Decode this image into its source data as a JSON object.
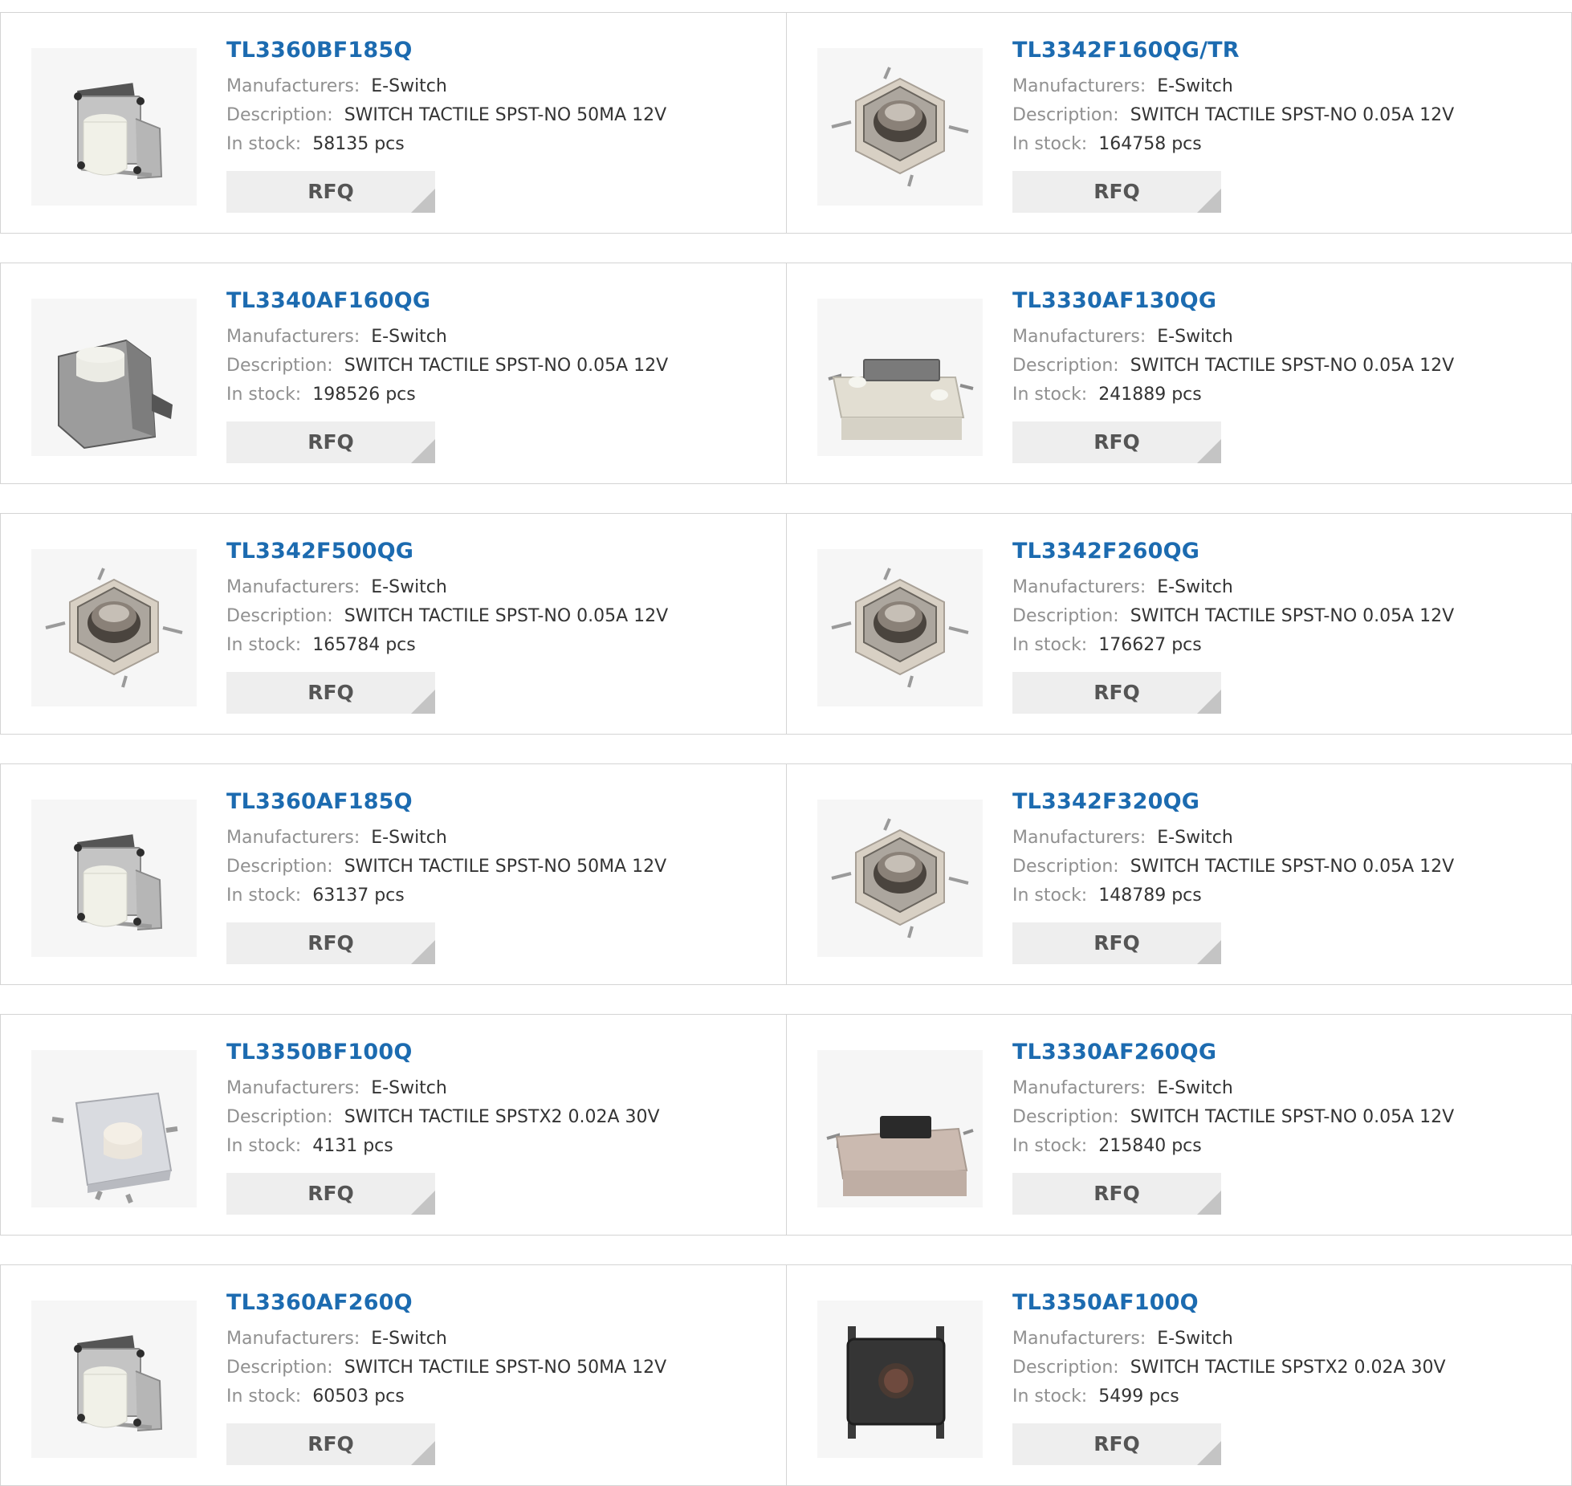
{
  "labels": {
    "manufacturers": "Manufacturers:",
    "description": "Description:",
    "in_stock": "In stock:",
    "rfq": "RFQ"
  },
  "products": [
    {
      "name": "TL3360BF185Q",
      "manufacturer": "E-Switch",
      "description": "SWITCH TACTILE SPST-NO 50MA 12V",
      "stock": "58135 pcs",
      "image_icon": "side-actuator-switch-icon"
    },
    {
      "name": "TL3342F160QG/TR",
      "manufacturer": "E-Switch",
      "description": "SWITCH TACTILE SPST-NO 0.05A 12V",
      "stock": "164758 pcs",
      "image_icon": "square-smd-switch-icon"
    },
    {
      "name": "TL3340AF160QG",
      "manufacturer": "E-Switch",
      "description": "SWITCH TACTILE SPST-NO 0.05A 12V",
      "stock": "198526 pcs",
      "image_icon": "right-angle-switch-icon"
    },
    {
      "name": "TL3330AF130QG",
      "manufacturer": "E-Switch",
      "description": "SWITCH TACTILE SPST-NO 0.05A 12V",
      "stock": "241889 pcs",
      "image_icon": "side-slim-switch-gray-icon"
    },
    {
      "name": "TL3342F500QG",
      "manufacturer": "E-Switch",
      "description": "SWITCH TACTILE SPST-NO 0.05A 12V",
      "stock": "165784 pcs",
      "image_icon": "square-smd-switch-icon"
    },
    {
      "name": "TL3342F260QG",
      "manufacturer": "E-Switch",
      "description": "SWITCH TACTILE SPST-NO 0.05A 12V",
      "stock": "176627 pcs",
      "image_icon": "square-smd-switch-icon"
    },
    {
      "name": "TL3360AF185Q",
      "manufacturer": "E-Switch",
      "description": "SWITCH TACTILE SPST-NO 50MA 12V",
      "stock": "63137 pcs",
      "image_icon": "side-actuator-switch-icon"
    },
    {
      "name": "TL3342F320QG",
      "manufacturer": "E-Switch",
      "description": "SWITCH TACTILE SPST-NO 0.05A 12V",
      "stock": "148789 pcs",
      "image_icon": "square-smd-switch-icon"
    },
    {
      "name": "TL3350BF100Q",
      "manufacturer": "E-Switch",
      "description": "SWITCH TACTILE SPSTX2 0.02A 30V",
      "stock": "4131 pcs",
      "image_icon": "white-smd-switch-icon"
    },
    {
      "name": "TL3330AF260QG",
      "manufacturer": "E-Switch",
      "description": "SWITCH TACTILE SPST-NO 0.05A 12V",
      "stock": "215840 pcs",
      "image_icon": "side-slim-switch-black-icon"
    },
    {
      "name": "TL3360AF260Q",
      "manufacturer": "E-Switch",
      "description": "SWITCH TACTILE SPST-NO 50MA 12V",
      "stock": "60503 pcs",
      "image_icon": "side-actuator-switch-icon"
    },
    {
      "name": "TL3350AF100Q",
      "manufacturer": "E-Switch",
      "description": "SWITCH TACTILE SPSTX2 0.02A 30V",
      "stock": "5499 pcs",
      "image_icon": "top-view-smd-switch-icon"
    }
  ]
}
